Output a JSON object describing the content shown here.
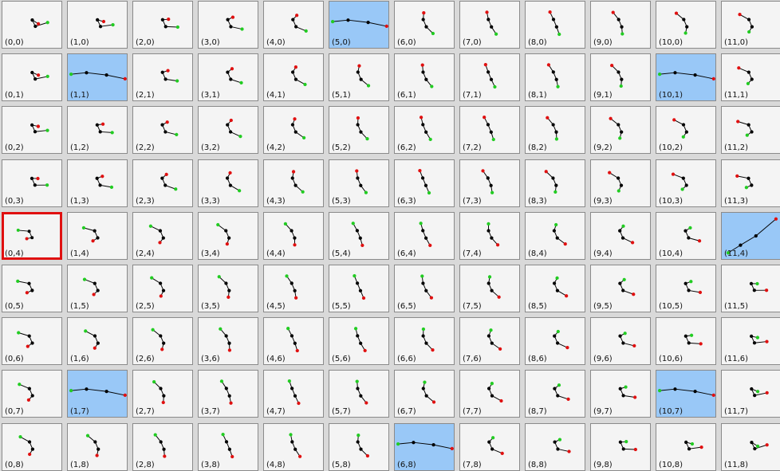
{
  "grid": {
    "cols": 12,
    "rows": 9,
    "label_format": "(col,row)",
    "selected_cells": [
      "5,0",
      "1,1",
      "10,1",
      "11,4",
      "1,7",
      "10,7",
      "6,8"
    ],
    "current_cell": "0,4"
  },
  "colors": {
    "cell_bg": "#f4f4f4",
    "selected_bg": "#99c8f7",
    "current_border": "#e01010",
    "start_point": "#22cc22",
    "end_point": "#e01010",
    "joint_point": "#000000",
    "segment": "#000000"
  },
  "icons": {
    "start": "green-dot-icon",
    "end": "red-dot-icon",
    "joint": "black-dot-icon"
  }
}
